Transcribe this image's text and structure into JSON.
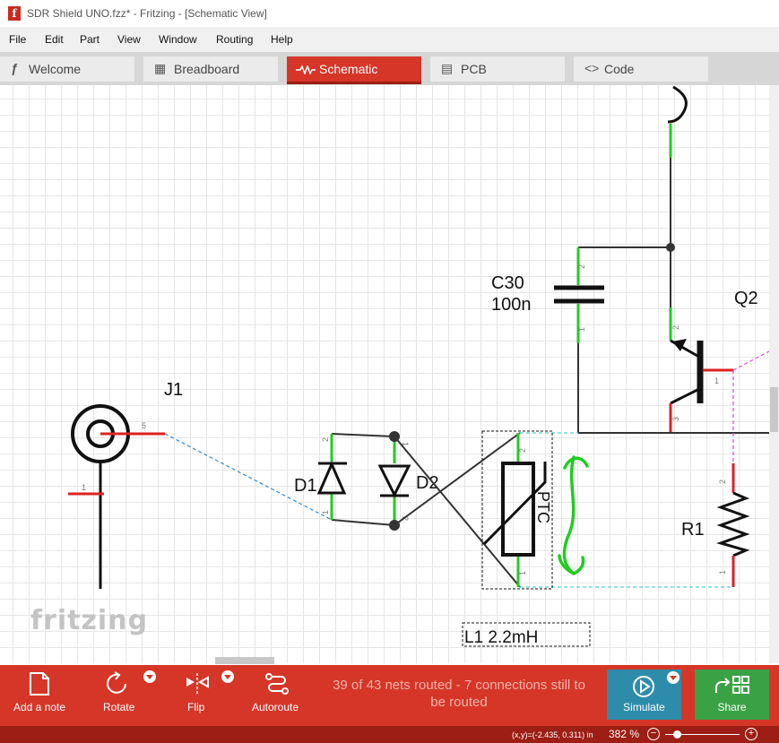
{
  "window": {
    "title": "SDR Shield UNO.fzz* - Fritzing - [Schematic View]",
    "app_icon": "f"
  },
  "menu": [
    "File",
    "Edit",
    "Part",
    "View",
    "Window",
    "Routing",
    "Help"
  ],
  "tabs": [
    {
      "label": "Welcome",
      "icon": "fritzing-f-icon",
      "glyph": "ƒ"
    },
    {
      "label": "Breadboard",
      "icon": "breadboard-icon",
      "glyph": "▦"
    },
    {
      "label": "Schematic",
      "icon": "schematic-icon",
      "glyph": ""
    },
    {
      "label": "PCB",
      "icon": "pcb-icon",
      "glyph": "▤"
    },
    {
      "label": "Code",
      "icon": "code-icon",
      "glyph": "<>"
    }
  ],
  "schematic": {
    "parts": {
      "c30": {
        "name": "C30",
        "value": "100n"
      },
      "q2": {
        "name": "Q2"
      },
      "j1": {
        "name": "J1"
      },
      "d1": {
        "name": "D1"
      },
      "d2": {
        "name": "D2"
      },
      "ptc": {
        "name": "PTC"
      },
      "r1": {
        "name": "R1"
      },
      "l1": {
        "name": "L1 2.2mH"
      }
    },
    "pins": {
      "c30_top": "2",
      "c30_bot": "1",
      "q2_e": "2",
      "q2_b": "1",
      "q2_c": "3",
      "j1_5": "5",
      "j1_1": "1",
      "d1_top": "2",
      "d1_bot": "1",
      "d2_top": "1",
      "d2_bot": "2",
      "ptc_top": "2",
      "ptc_bot": "1",
      "r1_top": "2",
      "r1_bot": "1"
    }
  },
  "watermark": "fritzing",
  "toolbar": {
    "add_note": "Add a note",
    "rotate": "Rotate",
    "flip": "Flip",
    "autoroute": "Autoroute",
    "status_line1": "39 of 43 nets routed - 7 connections still to",
    "status_line2": "be routed",
    "simulate": "Simulate",
    "share": "Share"
  },
  "footer": {
    "coords": "(x,y)=(-2.435, 0.311) in",
    "zoom": "382 %",
    "zoom_out": "−",
    "zoom_in": "+"
  },
  "colors": {
    "accent": "#d53628",
    "accent_dark": "#9c1e14",
    "simulate": "#2e8cab",
    "share": "#3aa245",
    "connected_pin": "#22cc22",
    "unconnected_pin": "#dd2222",
    "ratsnest": "#3388cc"
  }
}
